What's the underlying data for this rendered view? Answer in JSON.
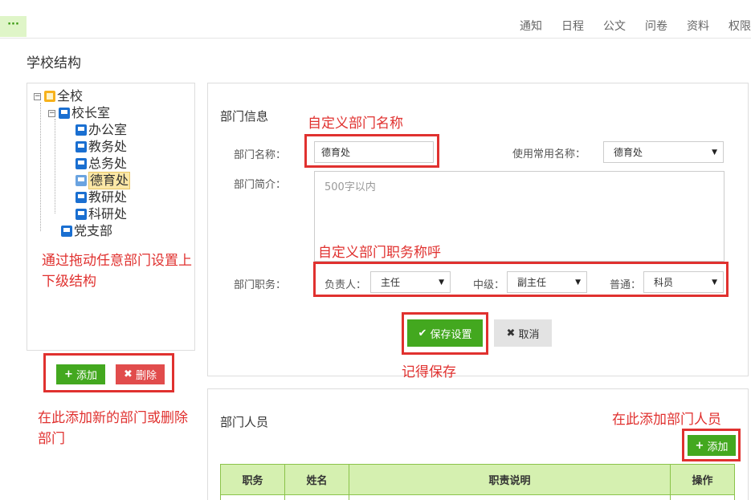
{
  "topbar": {
    "menu_glyph": "···",
    "nav": [
      "通知",
      "日程",
      "公文",
      "问卷",
      "资料",
      "权限"
    ]
  },
  "page_title": "学校结构",
  "tree": {
    "root": "全校",
    "principal_office": "校长室",
    "children": [
      "办公室",
      "教务处",
      "总务处",
      "德育处",
      "教研处",
      "科研处"
    ],
    "party": "党支部",
    "selected": "德育处",
    "toggle_glyph": "−"
  },
  "tree_hint": "通过拖动任意部门设置上下级结构",
  "left_actions": {
    "add_label": "添加",
    "delete_label": "删除",
    "hint": "在此添加新的部门或删除部门"
  },
  "dept_info": {
    "title": "部门信息",
    "name_note": "自定义部门名称",
    "name_label": "部门名称：",
    "name_value": "德育处",
    "common_name_label": "使用常用名称：",
    "common_name_value": "德育处",
    "intro_label": "部门简介：",
    "intro_placeholder": "500字以内",
    "duty_note": "自定义部门职务称呼",
    "duty_label": "部门职务：",
    "head_label": "负责人：",
    "head_value": "主任",
    "mid_label": "中级：",
    "mid_value": "副主任",
    "normal_label": "普通：",
    "normal_value": "科员",
    "save_label": "保存设置",
    "cancel_label": "取消",
    "save_note": "记得保存"
  },
  "staff": {
    "title": "部门人员",
    "add_note": "在此添加部门人员",
    "add_label": "添加",
    "columns": [
      "职务",
      "姓名",
      "职责说明",
      "操作"
    ]
  },
  "colors": {
    "accent_green": "#43a81f",
    "danger_red": "#e14c4c",
    "annotation_red": "#e0312f",
    "table_header": "#d5f0b0"
  }
}
